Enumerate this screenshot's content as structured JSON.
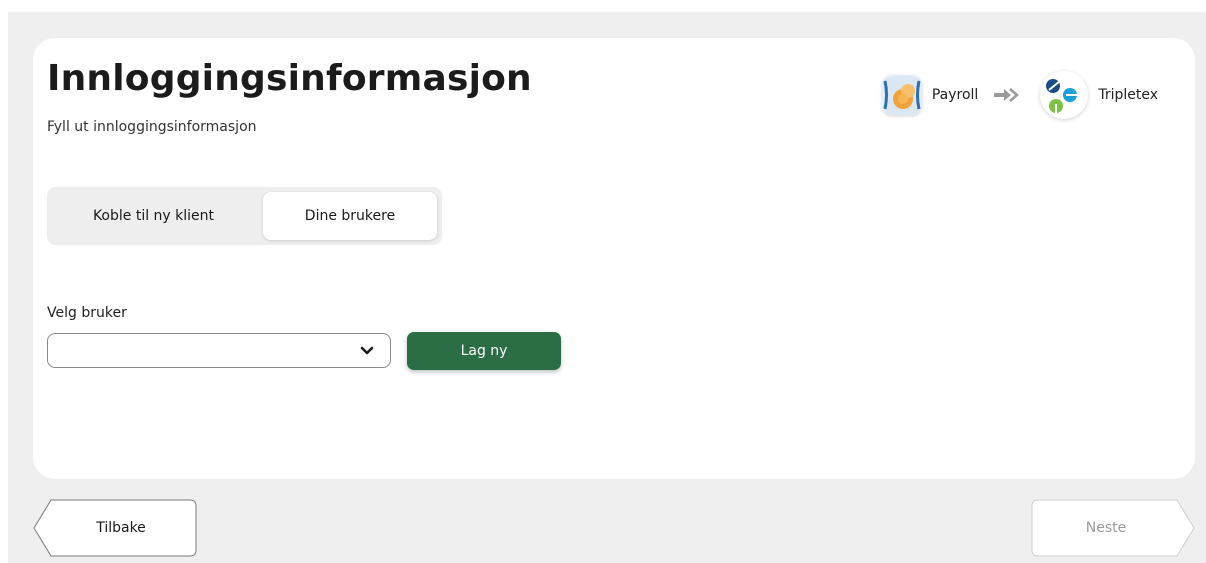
{
  "header": {
    "title": "Innloggingsinformasjon",
    "subtitle": "Fyll ut innloggingsinformasjon"
  },
  "integration": {
    "source_name": "Payroll",
    "target_name": "Tripletex",
    "source_icon": "payroll-logo-icon",
    "target_icon": "tripletex-logo-icon",
    "arrow_icon": "double-arrow-right-icon"
  },
  "tabs": [
    {
      "label": "Koble til ny klient",
      "active": false
    },
    {
      "label": "Dine brukere",
      "active": true
    }
  ],
  "user_select": {
    "label": "Velg bruker",
    "value": ""
  },
  "create_button": {
    "label": "Lag ny"
  },
  "navigation": {
    "back_label": "Tilbake",
    "next_label": "Neste",
    "next_enabled": false
  },
  "colors": {
    "primary": "#2b6e45",
    "page_background": "#efefef",
    "card_background": "#ffffff",
    "disabled_text": "#9a9a9a"
  }
}
